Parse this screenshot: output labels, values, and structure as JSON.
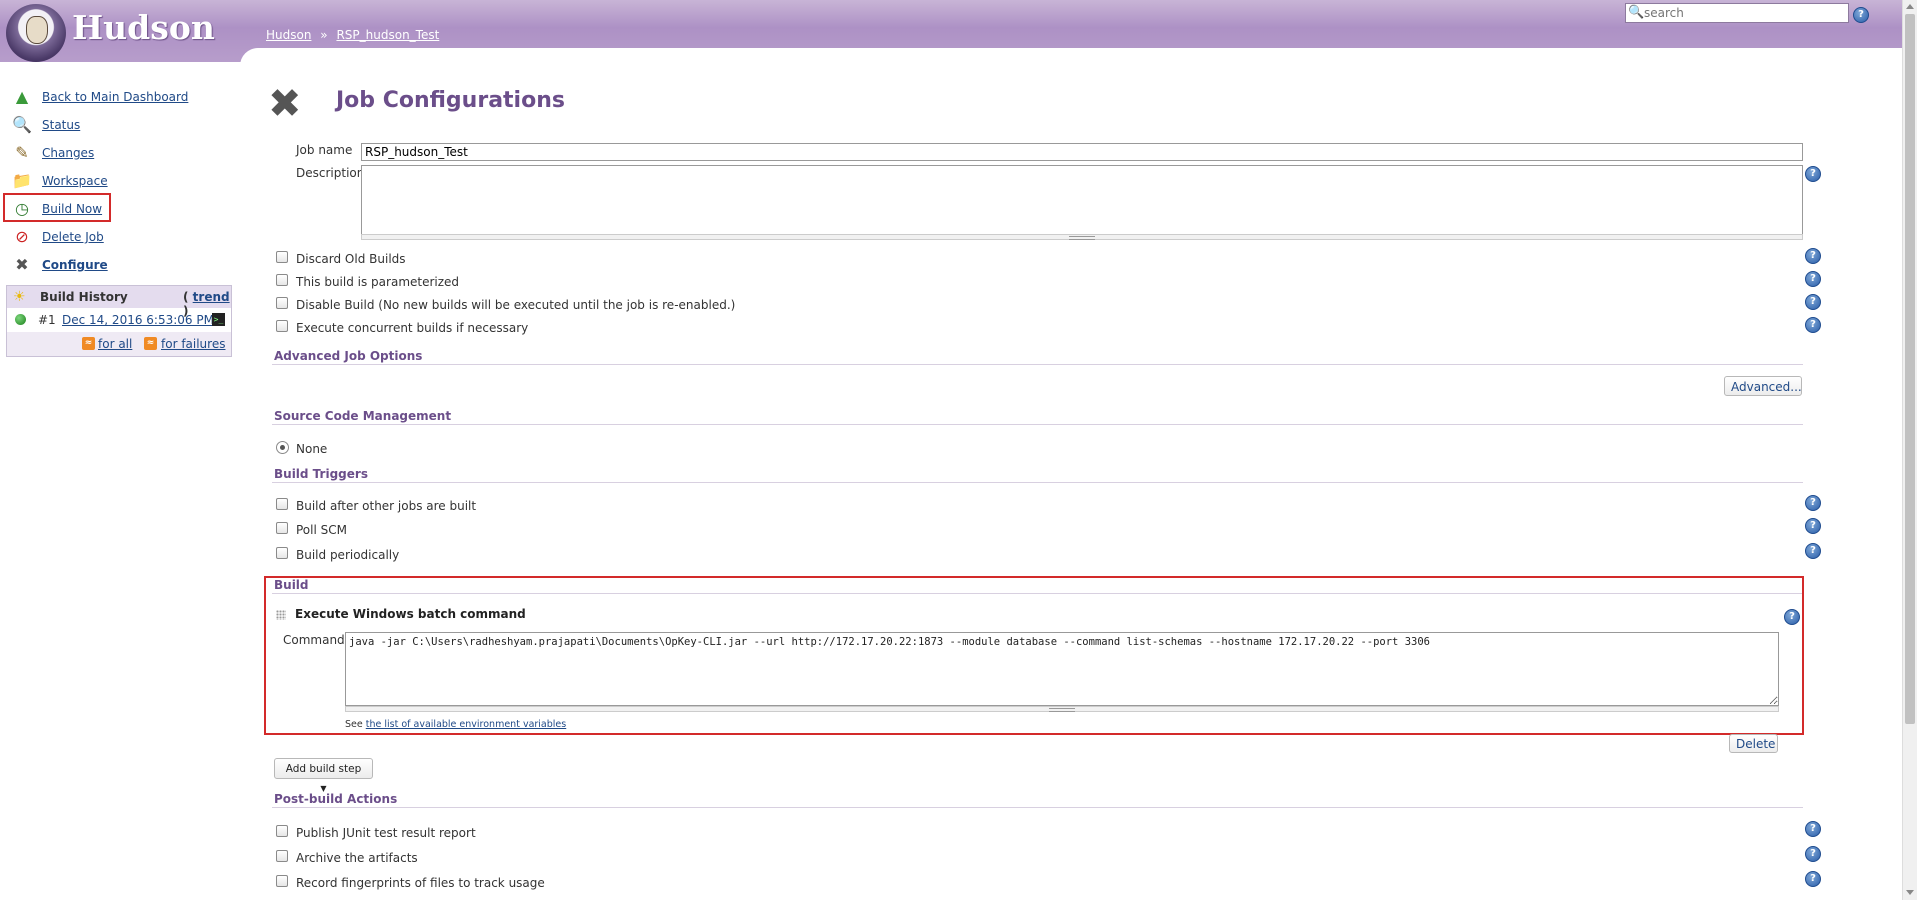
{
  "header": {
    "logo_text": "Hudson",
    "breadcrumb": [
      {
        "label": "Hudson"
      },
      {
        "label": "RSP_hudson_Test"
      }
    ],
    "breadcrumb_separator": "»",
    "search_placeholder": "search",
    "help_glyph": "?"
  },
  "sidebar": {
    "items": [
      {
        "label": "Back to Main Dashboard",
        "icon": "arrow-up-icon"
      },
      {
        "label": "Status",
        "icon": "magnifier-icon"
      },
      {
        "label": "Changes",
        "icon": "notepad-icon"
      },
      {
        "label": "Workspace",
        "icon": "folder-icon"
      },
      {
        "label": "Build Now",
        "icon": "clock-build-icon"
      },
      {
        "label": "Delete Job",
        "icon": "no-entry-icon"
      },
      {
        "label": "Configure",
        "icon": "wrench-screwdriver-icon"
      }
    ],
    "build_history": {
      "title": "Build History",
      "trend_open": "(",
      "trend_label": "trend",
      "trend_close": ")",
      "builds": [
        {
          "number": "#1",
          "date": "Dec 14, 2016 6:53:06 PM",
          "status_color": "#2ca02c"
        }
      ],
      "feed_all": "for all",
      "feed_failures": "for failures"
    }
  },
  "main": {
    "title": "Job Configurations",
    "job_name_label": "Job name",
    "job_name_value": "RSP_hudson_Test",
    "description_label": "Description",
    "description_value": "",
    "general_options": [
      {
        "label": "Discard Old Builds",
        "checked": false
      },
      {
        "label": "This build is parameterized",
        "checked": false
      },
      {
        "label": "Disable Build (No new builds will be executed until the job is re-enabled.)",
        "checked": false
      },
      {
        "label": "Execute concurrent builds if necessary",
        "checked": false
      }
    ],
    "advanced_job_options": {
      "title": "Advanced Job Options",
      "button": "Advanced..."
    },
    "scm": {
      "title": "Source Code Management",
      "options": [
        {
          "label": "None",
          "selected": true
        }
      ]
    },
    "build_triggers": {
      "title": "Build Triggers",
      "options": [
        {
          "label": "Build after other jobs are built",
          "checked": false
        },
        {
          "label": "Poll SCM",
          "checked": false
        },
        {
          "label": "Build periodically",
          "checked": false
        }
      ]
    },
    "build": {
      "title": "Build",
      "step_title": "Execute Windows batch command",
      "command_label": "Command",
      "command_value": "java -jar C:\\Users\\radheshyam.prajapati\\Documents\\OpKey-CLI.jar --url http://172.17.20.22:1873 --module database --command list-schemas --hostname 172.17.20.22 --port 3306",
      "env_note_prefix": "See",
      "env_note_link": "the list of available environment variables",
      "delete_button": "Delete",
      "add_build_step": "Add build step",
      "add_build_step_arrow": "▼"
    },
    "post_build": {
      "title": "Post-build Actions",
      "options": [
        {
          "label": "Publish JUnit test result report",
          "checked": false
        },
        {
          "label": "Archive the artifacts",
          "checked": false
        },
        {
          "label": "Record fingerprints of files to track usage",
          "checked": false
        }
      ]
    }
  },
  "colors": {
    "header_purple": "#ad91c5",
    "title_purple": "#6b4e8a",
    "link_blue": "#204a87",
    "highlight_red": "#d32a2a"
  }
}
